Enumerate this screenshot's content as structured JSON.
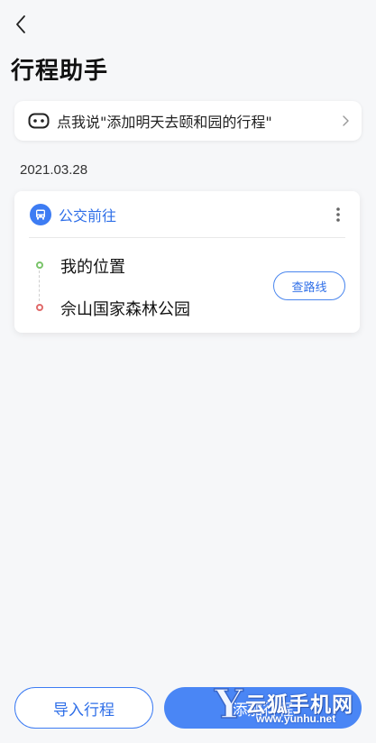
{
  "header": {
    "title": "行程助手"
  },
  "voice_hint": {
    "text": "点我说\"添加明天去颐和园的行程\""
  },
  "trip": {
    "date": "2021.03.28",
    "mode": "公交前往",
    "from": "我的位置",
    "to": "佘山国家森林公园",
    "route_button": "查路线"
  },
  "footer": {
    "import_label": "导入行程",
    "add_label": "添加行程"
  },
  "watermark": {
    "letter": "Y",
    "brand": "云狐手机网",
    "url": "www.yunhu.net"
  },
  "colors": {
    "accent": "#3d7cf3",
    "start_dot": "#7ac46a",
    "end_dot": "#e06a6a"
  },
  "icons": {
    "back": "chevron-left-icon",
    "assistant": "robot-icon",
    "hint_arrow": "chevron-right-icon",
    "transit": "bus-icon",
    "more": "more-vertical-icon"
  }
}
